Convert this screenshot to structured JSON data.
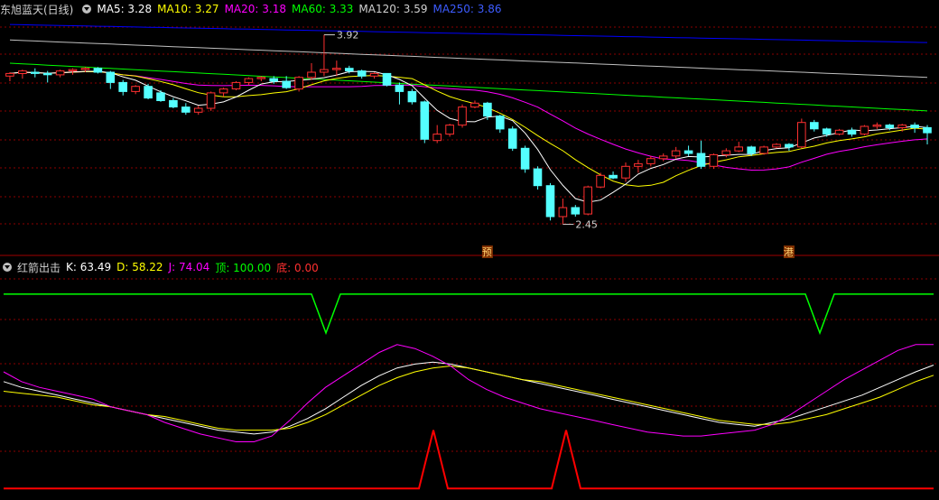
{
  "main_header": {
    "stock": "东旭蓝天(日线)",
    "ma5": "MA5: 3.28",
    "ma10": "MA10: 3.27",
    "ma20": "MA20: 3.18",
    "ma60": "MA60: 3.33",
    "ma120": "MA120: 3.59",
    "ma250": "MA250: 3.86"
  },
  "indicator_header": {
    "name": "红箭出击",
    "k": "K: 63.49",
    "d": "D: 58.22",
    "j": "J: 74.04",
    "top": "顶: 100.00",
    "bottom": "底: 0.00"
  },
  "annotations": {
    "high": "3.92",
    "low": "2.45",
    "mark1": "预",
    "mark2": "港"
  },
  "colors": {
    "ma5": "#ffffff",
    "ma10": "#ffff00",
    "ma20": "#ff00ff",
    "ma60": "#00ff00",
    "ma120": "#c0c0c0",
    "ma250": "#0000ff",
    "up": "#ff3030",
    "down": "#54ffff",
    "k": "#ffffff",
    "d": "#ffff00",
    "j": "#ff00ff",
    "top": "#00ff00",
    "bottom": "#ff0000",
    "grid": "#8b0000"
  },
  "chart_data": [
    {
      "type": "candlestick",
      "title": "东旭蓝天(日线)",
      "ylim": [
        2.3,
        4.05
      ],
      "grid": true,
      "candles": [
        [
          3.6,
          3.63,
          3.56,
          3.62
        ],
        [
          3.62,
          3.65,
          3.58,
          3.64
        ],
        [
          3.63,
          3.66,
          3.59,
          3.62
        ],
        [
          3.62,
          3.64,
          3.55,
          3.61
        ],
        [
          3.61,
          3.65,
          3.59,
          3.64
        ],
        [
          3.64,
          3.66,
          3.61,
          3.65
        ],
        [
          3.65,
          3.67,
          3.63,
          3.66
        ],
        [
          3.66,
          3.67,
          3.62,
          3.63
        ],
        [
          3.63,
          3.64,
          3.5,
          3.55
        ],
        [
          3.55,
          3.57,
          3.45,
          3.48
        ],
        [
          3.48,
          3.53,
          3.46,
          3.52
        ],
        [
          3.52,
          3.54,
          3.42,
          3.43
        ],
        [
          3.47,
          3.49,
          3.4,
          3.41
        ],
        [
          3.41,
          3.43,
          3.35,
          3.36
        ],
        [
          3.36,
          3.39,
          3.3,
          3.32
        ],
        [
          3.32,
          3.37,
          3.3,
          3.35
        ],
        [
          3.35,
          3.48,
          3.33,
          3.47
        ],
        [
          3.47,
          3.51,
          3.44,
          3.5
        ],
        [
          3.5,
          3.56,
          3.49,
          3.55
        ],
        [
          3.55,
          3.59,
          3.53,
          3.58
        ],
        [
          3.58,
          3.6,
          3.56,
          3.59
        ],
        [
          3.58,
          3.6,
          3.54,
          3.56
        ],
        [
          3.56,
          3.6,
          3.5,
          3.51
        ],
        [
          3.5,
          3.6,
          3.48,
          3.59
        ],
        [
          3.59,
          3.7,
          3.57,
          3.63
        ],
        [
          3.63,
          3.92,
          3.6,
          3.65
        ],
        [
          3.65,
          3.72,
          3.6,
          3.66
        ],
        [
          3.66,
          3.68,
          3.62,
          3.64
        ],
        [
          3.64,
          3.65,
          3.58,
          3.6
        ],
        [
          3.6,
          3.63,
          3.58,
          3.62
        ],
        [
          3.62,
          3.62,
          3.52,
          3.53
        ],
        [
          3.53,
          3.55,
          3.38,
          3.48
        ],
        [
          3.48,
          3.5,
          3.38,
          3.4
        ],
        [
          3.4,
          3.41,
          3.08,
          3.11
        ],
        [
          3.1,
          3.22,
          3.08,
          3.15
        ],
        [
          3.15,
          3.23,
          3.13,
          3.22
        ],
        [
          3.22,
          3.38,
          3.2,
          3.36
        ],
        [
          3.36,
          3.41,
          3.35,
          3.39
        ],
        [
          3.39,
          3.4,
          3.26,
          3.29
        ],
        [
          3.29,
          3.3,
          3.16,
          3.19
        ],
        [
          3.19,
          3.21,
          3.02,
          3.04
        ],
        [
          3.04,
          3.06,
          2.85,
          2.88
        ],
        [
          2.88,
          2.9,
          2.72,
          2.75
        ],
        [
          2.75,
          2.77,
          2.48,
          2.51
        ],
        [
          2.51,
          2.65,
          2.45,
          2.58
        ],
        [
          2.58,
          2.6,
          2.51,
          2.53
        ],
        [
          2.53,
          2.75,
          2.52,
          2.74
        ],
        [
          2.74,
          2.85,
          2.73,
          2.83
        ],
        [
          2.83,
          2.86,
          2.8,
          2.81
        ],
        [
          2.81,
          2.93,
          2.78,
          2.9
        ],
        [
          2.9,
          2.95,
          2.85,
          2.92
        ],
        [
          2.92,
          2.98,
          2.9,
          2.96
        ],
        [
          2.96,
          3.0,
          2.94,
          2.98
        ],
        [
          2.98,
          3.05,
          2.96,
          3.02
        ],
        [
          3.02,
          3.06,
          2.98,
          3.0
        ],
        [
          3.0,
          3.1,
          2.88,
          2.9
        ],
        [
          2.9,
          3.0,
          2.88,
          2.99
        ],
        [
          2.99,
          3.04,
          2.97,
          3.02
        ],
        [
          3.02,
          3.09,
          3.01,
          3.05
        ],
        [
          3.05,
          3.06,
          2.98,
          3.0
        ],
        [
          3.0,
          3.06,
          2.99,
          3.05
        ],
        [
          3.05,
          3.08,
          3.04,
          3.07
        ],
        [
          3.07,
          3.08,
          3.02,
          3.05
        ],
        [
          3.05,
          3.27,
          3.04,
          3.24
        ],
        [
          3.24,
          3.26,
          3.17,
          3.19
        ],
        [
          3.19,
          3.2,
          3.13,
          3.15
        ],
        [
          3.15,
          3.19,
          3.14,
          3.18
        ],
        [
          3.18,
          3.2,
          3.13,
          3.15
        ],
        [
          3.15,
          3.22,
          3.14,
          3.21
        ],
        [
          3.21,
          3.24,
          3.19,
          3.22
        ],
        [
          3.22,
          3.23,
          3.18,
          3.2
        ],
        [
          3.2,
          3.23,
          3.17,
          3.22
        ],
        [
          3.22,
          3.24,
          3.16,
          3.2
        ],
        [
          3.2,
          3.22,
          3.07,
          3.16
        ]
      ]
    },
    {
      "type": "line",
      "title": "红箭出击",
      "ylim": [
        -5,
        112
      ],
      "series": [
        {
          "name": "K",
          "values": [
            55,
            52,
            50,
            48,
            46,
            44,
            42,
            40,
            38,
            36,
            34,
            32,
            30,
            29,
            28,
            29,
            32,
            36,
            41,
            47,
            53,
            58,
            62,
            64,
            65,
            64,
            62,
            60,
            58,
            56,
            54,
            52,
            50,
            48,
            46,
            44,
            42,
            40,
            38,
            36,
            34,
            33,
            32,
            34,
            36,
            39,
            42,
            45,
            48,
            52,
            56,
            60,
            63.49
          ]
        },
        {
          "name": "D",
          "values": [
            50,
            49,
            48,
            47,
            45,
            43,
            42,
            40,
            38,
            37,
            35,
            33,
            31,
            30,
            30,
            30,
            31,
            34,
            38,
            43,
            48,
            53,
            57,
            60,
            62,
            63,
            62,
            60,
            58,
            56,
            55,
            53,
            51,
            49,
            47,
            45,
            43,
            41,
            39,
            37,
            35,
            34,
            33,
            33,
            34,
            36,
            38,
            41,
            44,
            47,
            51,
            55,
            58.22
          ]
        },
        {
          "name": "J",
          "values": [
            60,
            55,
            52,
            50,
            48,
            46,
            42,
            40,
            38,
            34,
            31,
            28,
            26,
            24,
            24,
            27,
            35,
            44,
            52,
            58,
            64,
            70,
            74,
            72,
            68,
            63,
            56,
            51,
            47,
            44,
            41,
            39,
            37,
            35,
            33,
            31,
            29,
            28,
            27,
            27,
            28,
            29,
            30,
            33,
            38,
            44,
            50,
            56,
            61,
            66,
            71,
            74,
            74.04
          ]
        },
        {
          "name": "顶",
          "values": [
            100,
            100
          ]
        },
        {
          "name": "底",
          "values": [
            0,
            0
          ]
        }
      ]
    }
  ]
}
